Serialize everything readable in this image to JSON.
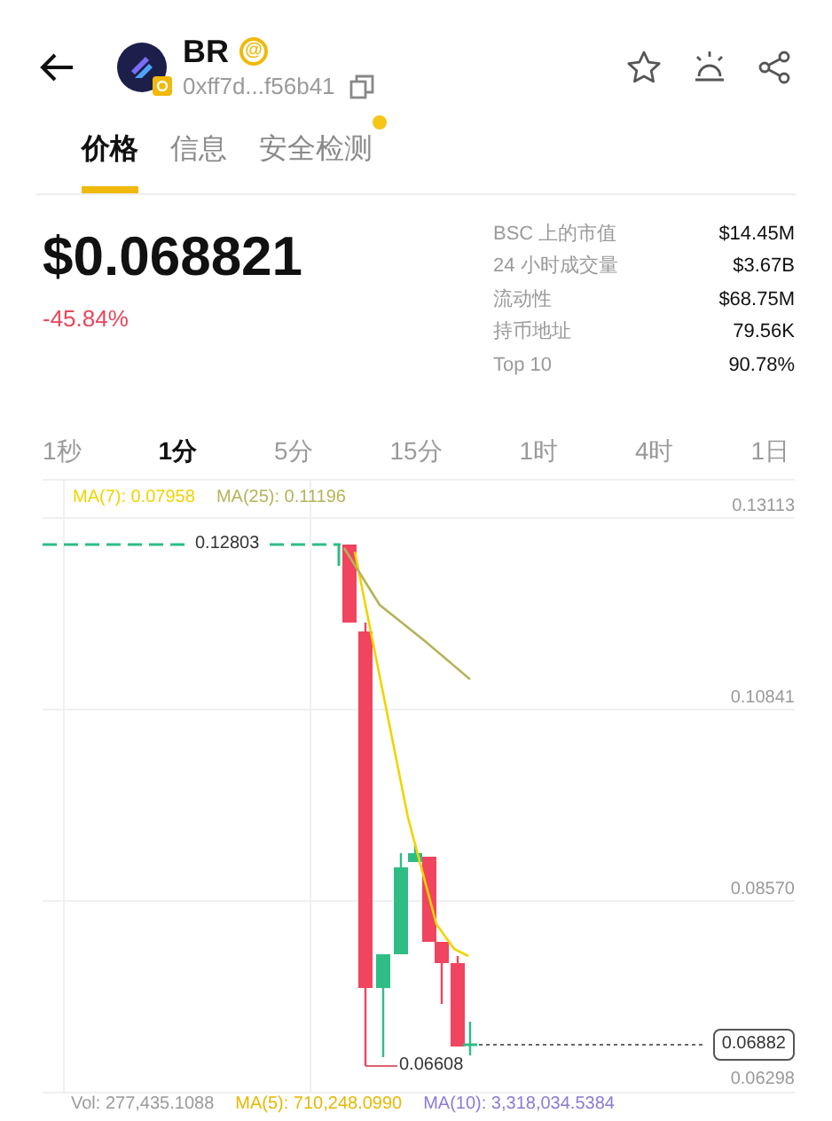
{
  "header": {
    "symbol": "BR",
    "badge": "@",
    "address": "0xff7d...f56b41"
  },
  "tabs": [
    {
      "label": "价格",
      "selected": true,
      "dot": false
    },
    {
      "label": "信息",
      "selected": false,
      "dot": false
    },
    {
      "label": "安全检测",
      "selected": false,
      "dot": true
    }
  ],
  "price": "$0.068821",
  "change": "-45.84%",
  "stats": [
    {
      "label": "BSC 上的市值",
      "value": "$14.45M"
    },
    {
      "label": "24 小时成交量",
      "value": "$3.67B"
    },
    {
      "label": "流动性",
      "value": "$68.75M"
    },
    {
      "label": "持币地址",
      "value": "79.56K"
    },
    {
      "label": "Top 10",
      "value": "90.78%"
    }
  ],
  "intervals": [
    {
      "label": "1秒",
      "selected": false
    },
    {
      "label": "1分",
      "selected": true
    },
    {
      "label": "5分",
      "selected": false
    },
    {
      "label": "15分",
      "selected": false
    },
    {
      "label": "1时",
      "selected": false
    },
    {
      "label": "4时",
      "selected": false
    },
    {
      "label": "1日",
      "selected": false
    }
  ],
  "chart": {
    "ma_legend": [
      {
        "text": "MA(7): 0.07958",
        "color": "#f0d400"
      },
      {
        "text": "MA(25): 0.11196",
        "color": "#b5b45a"
      }
    ],
    "y_ticks": [
      "0.13113",
      "0.10841",
      "0.08570",
      "0.06298"
    ],
    "high_label": "0.12803",
    "low_label": "0.06608",
    "last_price": "0.06882",
    "volume_legend": [
      {
        "text": "Vol: 277,435.1088",
        "color": "#9a9a9a"
      },
      {
        "text": "MA(5): 710,248.0990",
        "color": "#e6b800"
      },
      {
        "text": "MA(10): 3,318,034.5384",
        "color": "#8e7ad6"
      }
    ]
  }
}
